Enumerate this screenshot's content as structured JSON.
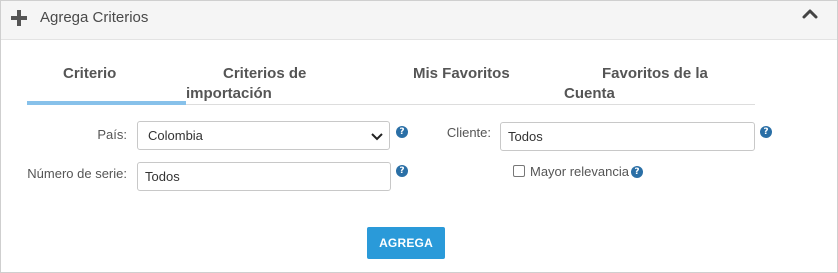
{
  "header": {
    "title": "Agrega Criterios"
  },
  "tabs": [
    {
      "label": "Criterio",
      "active": true
    },
    {
      "label": "Criterios de importación",
      "active": false
    },
    {
      "label": "Mis Favoritos",
      "active": false
    },
    {
      "label": "Favoritos de la Cuenta",
      "active": false
    }
  ],
  "tab_lines": {
    "criterios_line1": "Criterios de",
    "criterios_line2": "importación",
    "favcuenta_line1": "Favoritos de la",
    "favcuenta_line2": "Cuenta"
  },
  "form": {
    "pais_label": "País:",
    "pais_value": "Colombia",
    "cliente_label": "Cliente:",
    "cliente_value": "Todos",
    "serie_label": "Número de serie:",
    "serie_value": "Todos",
    "relevancia_label": "Mayor relevancia",
    "relevancia_checked": false,
    "help_glyph": "?"
  },
  "actions": {
    "agrega_label": "AGREGA"
  },
  "colors": {
    "accent": "#2a9ad9",
    "active_tab_bar": "#87c1ea",
    "help_icon": "#2a6fa6"
  }
}
